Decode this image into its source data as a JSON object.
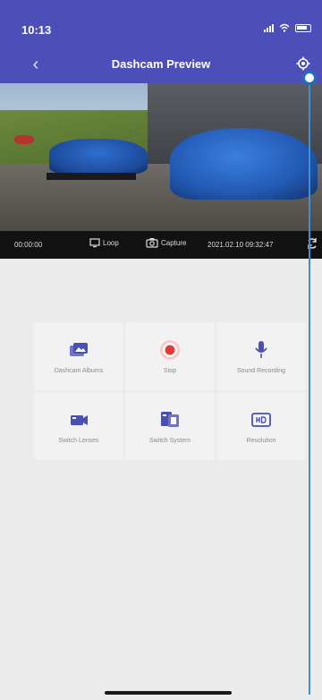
{
  "status_bar": {
    "time": "10:13"
  },
  "nav": {
    "title": "Dashcam Preview"
  },
  "preview": {
    "overlay": {
      "elapsed": "00:00:00",
      "loop_label": "Loop",
      "capture_label": "Capture",
      "timestamp": "2021.02.10 09:32:47"
    }
  },
  "grid": {
    "tiles": [
      {
        "label": "Dashcam Albums",
        "icon": "albums-icon",
        "color": "#4a4fb3"
      },
      {
        "label": "Stop",
        "icon": "record-icon",
        "color": "#e23a3a"
      },
      {
        "label": "Sound Recording",
        "icon": "microphone-icon",
        "color": "#4a4fb3"
      },
      {
        "label": "Switch Lenses",
        "icon": "camera-switch-icon",
        "color": "#4a4fb3"
      },
      {
        "label": "Switch System",
        "icon": "system-icon",
        "color": "#4a4fb3"
      },
      {
        "label": "Resolution",
        "icon": "hd-icon",
        "color": "#4a4fb3"
      }
    ]
  },
  "colors": {
    "header": "#4d4fb8",
    "background": "#ebebeb",
    "accent": "#3d8fd6"
  }
}
